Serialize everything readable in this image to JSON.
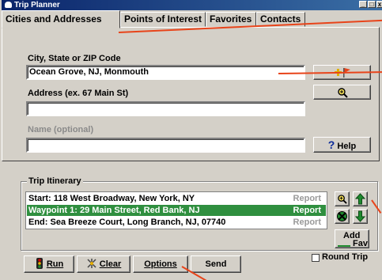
{
  "window": {
    "title": "Trip Planner",
    "minimize": "_",
    "maximize": "□",
    "close": "x"
  },
  "tabs": [
    {
      "label": "Cities and Addresses"
    },
    {
      "label": "Points of Interest"
    },
    {
      "label": "Favorites"
    },
    {
      "label": "Contacts"
    }
  ],
  "form": {
    "city_label": "City, State or ZIP Code",
    "city_value": "Ocean Grove, NJ, Monmouth",
    "address_label": "Address (ex. 67 Main St)",
    "address_value": "",
    "name_label": "Name (optional)",
    "name_value": "",
    "help_label": "Help"
  },
  "itinerary": {
    "title": "Trip Itinerary",
    "rows": [
      {
        "text": "Start: 118 West Broadway, New York, NY",
        "report": "Report",
        "selected": false
      },
      {
        "text": "Waypoint 1: 29 Main Street, Red Bank, NJ",
        "report": "Report",
        "selected": true
      },
      {
        "text": "End: Sea Breeze Court, Long Branch, NJ, 07740",
        "report": "Report",
        "selected": false
      }
    ],
    "add_fav_top": "Add",
    "add_fav_bottom": "Fav"
  },
  "bottom": {
    "run_label": "Run",
    "clear_label": "Clear",
    "options_label": "Options",
    "send_label": "Send",
    "round_trip_label": "Round Trip"
  },
  "colors": {
    "annotation": "#e8441a",
    "selection": "#2f8f3f",
    "arrow_green": "#1f8a2e"
  }
}
